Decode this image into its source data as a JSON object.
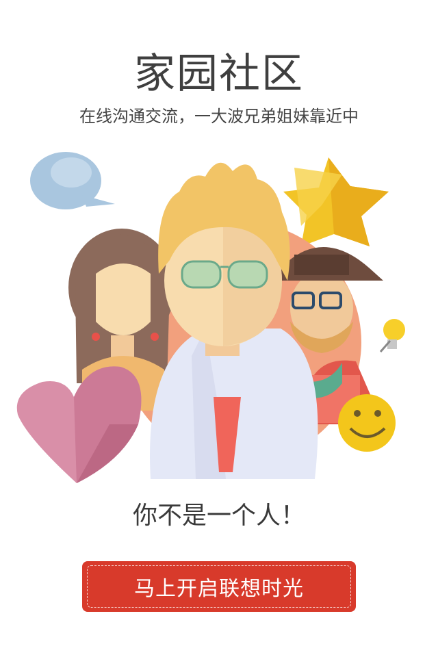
{
  "header": {
    "title": "家园社区",
    "subtitle": "在线沟通交流，一大波兄弟姐妹靠近中"
  },
  "illustration": {
    "icons": [
      "speech-bubble-icon",
      "star-icon",
      "lightbulb-icon",
      "smiley-icon",
      "heart-icon"
    ]
  },
  "tagline": "你不是一个人！",
  "cta": {
    "label": "马上开启联想时光"
  },
  "colors": {
    "cta_background": "#d83a2b",
    "title_text": "#3f3f3f"
  }
}
